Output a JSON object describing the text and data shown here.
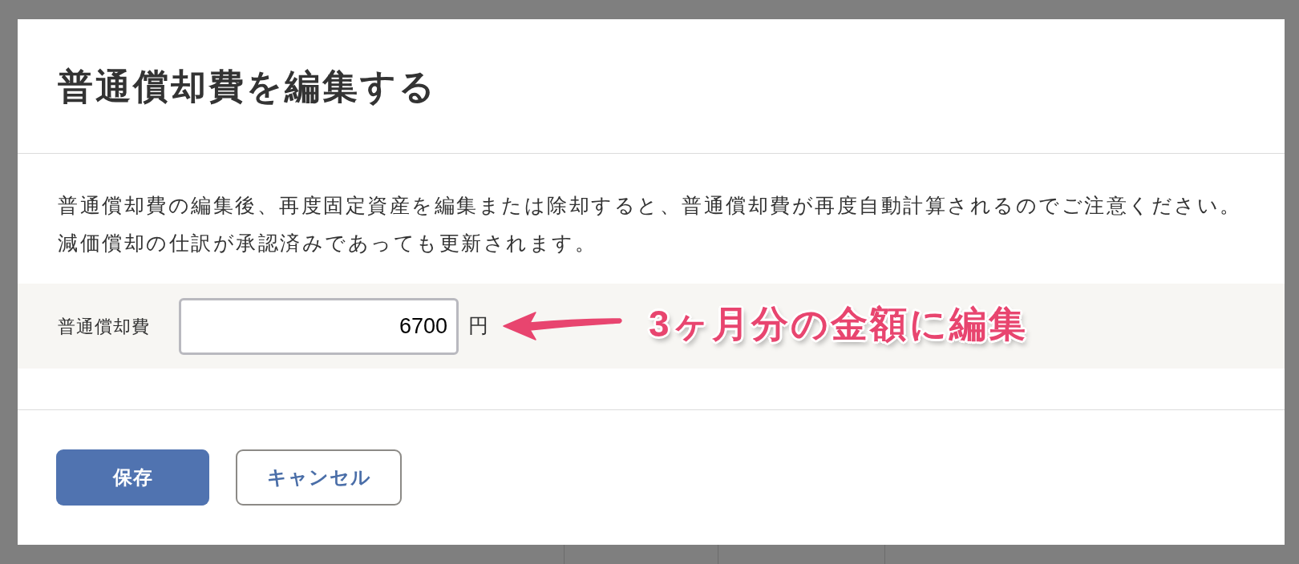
{
  "dialog": {
    "title": "普通償却費を編集する",
    "message": [
      "普通償却費の編集後、再度固定資産を編集または除却すると、普通償却費が再度自動計算されるのでご注意ください。",
      "減価償却の仕訳が承認済みであっても更新されます。"
    ],
    "field": {
      "label": "普通償却費",
      "value": "6700",
      "unit": "円"
    },
    "buttons": [
      {
        "label": "保存",
        "kind": "primary"
      },
      {
        "label": "キャンセル",
        "kind": "secondary"
      }
    ]
  },
  "annotation": {
    "text": "3ヶ月分の金額に編集"
  }
}
